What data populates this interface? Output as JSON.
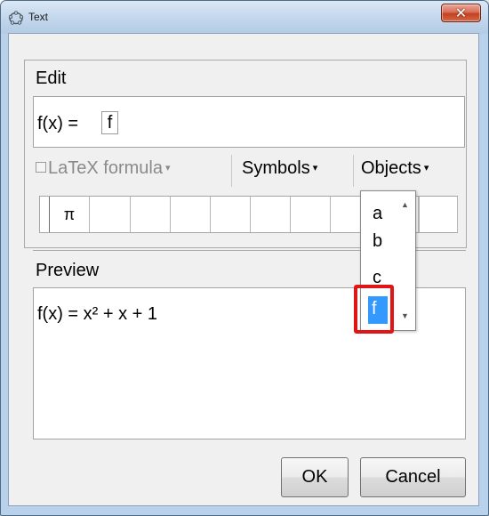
{
  "window": {
    "title": "Text",
    "close_glyph": "✕"
  },
  "edit": {
    "label": "Edit",
    "text_prefix": "f(x) = ",
    "token": "f"
  },
  "toolbar": {
    "latex_label": "LaTeX formula",
    "symbols_label": "Symbols",
    "objects_label": "Objects",
    "caret": "▾"
  },
  "symbol_strip": {
    "cells": [
      "π",
      "",
      "",
      "",
      "",
      "",
      "",
      "",
      "",
      "",
      ""
    ]
  },
  "preview": {
    "label": "Preview",
    "text": "f(x) = x² + x + 1"
  },
  "objects_dropdown": {
    "items": [
      "a",
      "b",
      "c",
      "f"
    ],
    "selected": "f"
  },
  "buttons": {
    "ok": "OK",
    "cancel": "Cancel"
  },
  "colors": {
    "selection": "#3399ff",
    "highlight_border": "#e01515",
    "dialog_bg": "#f0f0f0",
    "titlebar": "#c6d9ee"
  }
}
